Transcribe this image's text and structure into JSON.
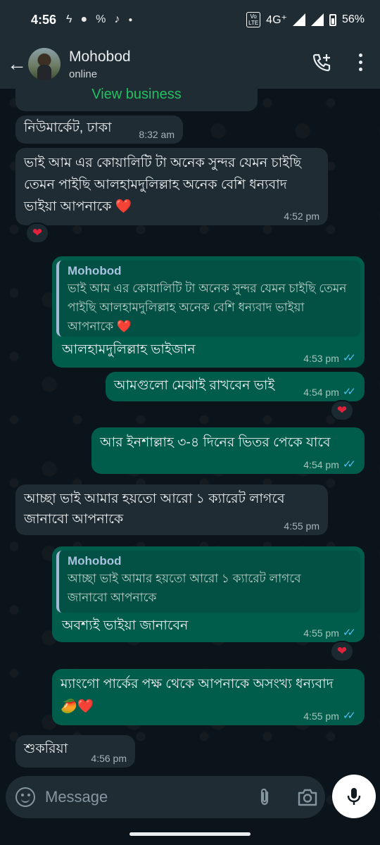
{
  "status_bar": {
    "time": "4:56",
    "network": "4G⁺",
    "battery": "56%",
    "volte": "Vo LTE"
  },
  "header": {
    "contact_name": "Mohobod",
    "status": "online"
  },
  "business_link": "View business",
  "messages": [
    {
      "dir": "in",
      "text": "নিউমার্কেট, ঢাকা",
      "time": "8:32 am"
    },
    {
      "dir": "in",
      "text": "ভাই আম এর কোয়ালিটি টা অনেক সুন্দর  যেমন চাইছি তেমন পাইছি আলহামদুলিল্লাহ  অনেক বেশি ধন্যবাদ ভাইয়া আপনাকে ❤️",
      "time": "4:52 pm",
      "reaction": "❤"
    },
    {
      "dir": "out",
      "quote_name": "Mohobod",
      "quote_text": "ভাই আম এর কোয়ালিটি টা অনেক সুন্দর  যেমন চাইছি তেমন পাইছি আলহামদুলিল্লাহ  অনেক বেশি ধন্যবাদ ভাইয়া আপনাকে ❤️",
      "text": "আলহামদুলিল্লাহ ভাইজান",
      "time": "4:53 pm"
    },
    {
      "dir": "out",
      "text": "আমগুলো মেঝাই রাখবেন ভাই",
      "time": "4:54 pm",
      "reaction": "❤"
    },
    {
      "dir": "out",
      "text": "আর ইনশাল্লাহ ৩-৪ দিনের ভিতর পেকে যাবে",
      "time": "4:54 pm"
    },
    {
      "dir": "in",
      "text": "আচ্ছা ভাই  আমার হয়তো আরো ১ ক্যারেট লাগবে জানাবো আপনাকে",
      "time": "4:55 pm"
    },
    {
      "dir": "out",
      "quote_name": "Mohobod",
      "quote_text": "আচ্ছা ভাই  আমার হয়তো আরো ১ ক্যারেট লাগবে জানাবো আপনাকে",
      "text": "অবশ্যই ভাইয়া জানাবেন",
      "time": "4:55 pm",
      "reaction": "❤"
    },
    {
      "dir": "out",
      "text": "ম্যাংগো পার্কের পক্ষ থেকে আপনাকে অসংখ্য ধন্যবাদ 🥭❤️",
      "time": "4:55 pm"
    },
    {
      "dir": "in",
      "text": "শুকরিয়া",
      "time": "4:56 pm"
    }
  ],
  "input": {
    "placeholder": "Message"
  },
  "colors": {
    "background": "#0b141a",
    "incoming": "#202c33",
    "outgoing": "#005c4b",
    "accent_green": "#21c063",
    "read_tick": "#53bdeb"
  }
}
